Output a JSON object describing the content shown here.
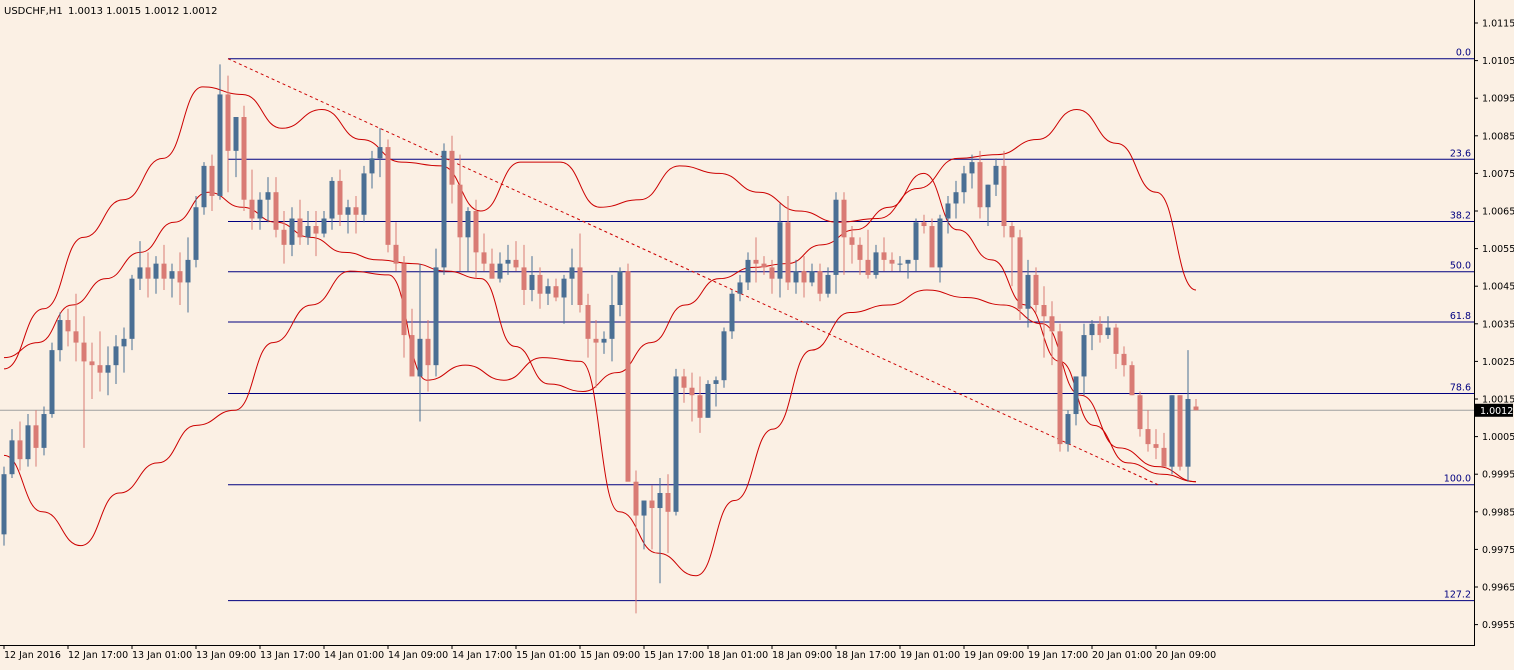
{
  "header": {
    "symbol": "USDCHF,H1",
    "ohlc": "1.0013 1.0015 1.0012 1.0012"
  },
  "colors": {
    "background": "#FBF0E4",
    "bull_candle": "#4A6F94",
    "bear_candle": "#D97B74",
    "bollinger": "#CC0000",
    "fib_lines": "#000080",
    "trendline": "#CC0000",
    "axis": "#000000"
  },
  "chart_data": {
    "type": "candlestick",
    "symbol": "USDCHF",
    "timeframe": "H1",
    "current_price": "1.0012",
    "price_axis": {
      "ticks": [
        "1.0115",
        "1.0105",
        "1.0095",
        "1.0085",
        "1.0075",
        "1.0065",
        "1.0055",
        "1.0045",
        "1.0035",
        "1.0025",
        "1.0015",
        "1.0005",
        "0.9995",
        "0.9985",
        "0.9975",
        "0.9965",
        "0.9955"
      ],
      "range": [
        0.9952,
        1.0118
      ]
    },
    "time_axis": {
      "labels": [
        "12 Jan 2016",
        "12 Jan 17:00",
        "13 Jan 01:00",
        "13 Jan 09:00",
        "13 Jan 17:00",
        "14 Jan 01:00",
        "14 Jan 09:00",
        "14 Jan 17:00",
        "15 Jan 01:00",
        "15 Jan 09:00",
        "15 Jan 17:00",
        "18 Jan 01:00",
        "18 Jan 09:00",
        "18 Jan 17:00",
        "19 Jan 01:00",
        "19 Jan 09:00",
        "19 Jan 17:00",
        "20 Jan 01:00",
        "20 Jan 09:00"
      ]
    },
    "fibonacci": {
      "high": 1.01055,
      "low": 0.99922,
      "levels": [
        {
          "label": "0.0",
          "ratio": 0.0
        },
        {
          "label": "23.6",
          "ratio": 0.236
        },
        {
          "label": "38.2",
          "ratio": 0.382
        },
        {
          "label": "50.0",
          "ratio": 0.5
        },
        {
          "label": "61.8",
          "ratio": 0.618
        },
        {
          "label": "78.6",
          "ratio": 0.786
        },
        {
          "label": "100.0",
          "ratio": 1.0
        },
        {
          "label": "127.2",
          "ratio": 1.272
        }
      ]
    },
    "candles": [
      [
        0.9979,
        0.9997,
        0.9976,
        0.9995
      ],
      [
        0.9995,
        1.0007,
        0.9994,
        1.0004
      ],
      [
        1.0004,
        1.0009,
        0.9996,
        0.9999
      ],
      [
        0.9999,
        1.0011,
        0.9997,
        1.0008
      ],
      [
        1.0008,
        1.0012,
        0.9997,
        1.0002
      ],
      [
        1.0002,
        1.0013,
        1.0,
        1.0011
      ],
      [
        1.0011,
        1.003,
        1.001,
        1.0028
      ],
      [
        1.0028,
        1.0038,
        1.0025,
        1.0036
      ],
      [
        1.0036,
        1.0039,
        1.0029,
        1.0033
      ],
      [
        1.0033,
        1.0043,
        1.0025,
        1.003
      ],
      [
        1.003,
        1.0037,
        1.0002,
        1.0025
      ],
      [
        1.0025,
        1.003,
        1.0015,
        1.0024
      ],
      [
        1.0024,
        1.0033,
        1.0017,
        1.0022
      ],
      [
        1.0022,
        1.0029,
        1.0016,
        1.0024
      ],
      [
        1.0024,
        1.0032,
        1.0019,
        1.0029
      ],
      [
        1.0029,
        1.0034,
        1.0022,
        1.0031
      ],
      [
        1.0031,
        1.0048,
        1.0028,
        1.0047
      ],
      [
        1.0047,
        1.0057,
        1.0044,
        1.005
      ],
      [
        1.005,
        1.0054,
        1.0042,
        1.0047
      ],
      [
        1.0047,
        1.0053,
        1.0043,
        1.0051
      ],
      [
        1.0051,
        1.0056,
        1.0044,
        1.0047
      ],
      [
        1.0047,
        1.0051,
        1.0042,
        1.0049
      ],
      [
        1.0049,
        1.0054,
        1.004,
        1.0046
      ],
      [
        1.0046,
        1.0058,
        1.0038,
        1.0052
      ],
      [
        1.0052,
        1.0069,
        1.005,
        1.0066
      ],
      [
        1.0066,
        1.0078,
        1.0064,
        1.0077
      ],
      [
        1.0077,
        1.008,
        1.0065,
        1.0069
      ],
      [
        1.0069,
        1.0104,
        1.0068,
        1.0096
      ],
      [
        1.0096,
        1.0101,
        1.007,
        1.0081
      ],
      [
        1.0081,
        1.0088,
        1.0074,
        1.009
      ],
      [
        1.009,
        1.0093,
        1.0065,
        1.0068
      ],
      [
        1.0068,
        1.0076,
        1.006,
        1.0063
      ],
      [
        1.0063,
        1.007,
        1.006,
        1.0068
      ],
      [
        1.0068,
        1.0074,
        1.0062,
        1.007
      ],
      [
        1.007,
        1.0074,
        1.0058,
        1.006
      ],
      [
        1.006,
        1.0065,
        1.0051,
        1.0056
      ],
      [
        1.0056,
        1.0066,
        1.0053,
        1.0063
      ],
      [
        1.0063,
        1.0068,
        1.0056,
        1.0058
      ],
      [
        1.0058,
        1.0065,
        1.0056,
        1.0061
      ],
      [
        1.0061,
        1.0065,
        1.0053,
        1.0059
      ],
      [
        1.0059,
        1.0065,
        1.0058,
        1.0063
      ],
      [
        1.0063,
        1.0074,
        1.006,
        1.0073
      ],
      [
        1.0073,
        1.0076,
        1.0061,
        1.0064
      ],
      [
        1.0064,
        1.0068,
        1.0059,
        1.0066
      ],
      [
        1.0066,
        1.0069,
        1.0059,
        1.0064
      ],
      [
        1.0064,
        1.0077,
        1.0062,
        1.0075
      ],
      [
        1.0075,
        1.0081,
        1.0071,
        1.0079
      ],
      [
        1.0079,
        1.0087,
        1.0074,
        1.0082
      ],
      [
        1.0082,
        1.0084,
        1.0054,
        1.0056
      ],
      [
        1.0056,
        1.0062,
        1.0049,
        1.0051
      ],
      [
        1.0051,
        1.0053,
        1.0026,
        1.0032
      ],
      [
        1.0032,
        1.0039,
        1.0022,
        1.0021
      ],
      [
        1.0021,
        1.0051,
        1.0009,
        1.0031
      ],
      [
        1.0031,
        1.0036,
        1.0017,
        1.0024
      ],
      [
        1.0024,
        1.0055,
        1.0021,
        1.005
      ],
      [
        1.005,
        1.0083,
        1.0048,
        1.0081
      ],
      [
        1.0081,
        1.0085,
        1.0067,
        1.0072
      ],
      [
        1.0072,
        1.008,
        1.0049,
        1.0058
      ],
      [
        1.0058,
        1.0066,
        1.0049,
        1.0065
      ],
      [
        1.0065,
        1.0068,
        1.0047,
        1.0054
      ],
      [
        1.0054,
        1.0059,
        1.0049,
        1.0051
      ],
      [
        1.0051,
        1.0055,
        1.0047,
        1.0047
      ],
      [
        1.0047,
        1.0054,
        1.0046,
        1.0051
      ],
      [
        1.0051,
        1.0056,
        1.0048,
        1.0052
      ],
      [
        1.0052,
        1.0057,
        1.0049,
        1.005
      ],
      [
        1.005,
        1.0056,
        1.004,
        1.0044
      ],
      [
        1.0044,
        1.0053,
        1.0041,
        1.0048
      ],
      [
        1.0048,
        1.005,
        1.0039,
        1.0043
      ],
      [
        1.0043,
        1.0047,
        1.004,
        1.0045
      ],
      [
        1.0045,
        1.0047,
        1.0041,
        1.0042
      ],
      [
        1.0042,
        1.0048,
        1.0035,
        1.0047
      ],
      [
        1.0047,
        1.0055,
        1.004,
        1.005
      ],
      [
        1.005,
        1.0059,
        1.0038,
        1.004
      ],
      [
        1.004,
        1.0043,
        1.0026,
        1.0031
      ],
      [
        1.0031,
        1.0036,
        1.0018,
        1.003
      ],
      [
        1.003,
        1.0033,
        1.0027,
        1.0031
      ],
      [
        1.0031,
        1.0048,
        1.0025,
        1.004
      ],
      [
        1.004,
        1.005,
        1.0037,
        1.0049
      ],
      [
        1.0049,
        1.0051,
        0.9996,
        0.9993
      ],
      [
        0.9993,
        0.9996,
        0.9958,
        0.9984
      ],
      [
        0.9984,
        0.9988,
        0.9975,
        0.9988
      ],
      [
        0.9988,
        0.9992,
        0.9975,
        0.9986
      ],
      [
        0.9986,
        0.9994,
        0.9966,
        0.999
      ],
      [
        0.999,
        0.9995,
        0.9974,
        0.9985
      ],
      [
        0.9985,
        1.0023,
        0.9984,
        1.0021
      ],
      [
        1.0021,
        1.0023,
        1.0014,
        1.0018
      ],
      [
        1.0018,
        1.0022,
        1.0009,
        1.0016
      ],
      [
        1.0016,
        1.0021,
        1.0006,
        1.001
      ],
      [
        1.001,
        1.002,
        1.001,
        1.0019
      ],
      [
        1.0019,
        1.0021,
        1.0013,
        1.002
      ],
      [
        1.002,
        1.0034,
        1.0018,
        1.0033
      ],
      [
        1.0033,
        1.0044,
        1.0031,
        1.0043
      ],
      [
        1.0043,
        1.0048,
        1.0041,
        1.0046
      ],
      [
        1.0046,
        1.0054,
        1.0044,
        1.0052
      ],
      [
        1.0052,
        1.0058,
        1.0046,
        1.0051
      ],
      [
        1.0051,
        1.0053,
        1.0048,
        1.005
      ],
      [
        1.005,
        1.0052,
        1.0043,
        1.0047
      ],
      [
        1.0047,
        1.0067,
        1.0042,
        1.0062
      ],
      [
        1.0062,
        1.0069,
        1.0044,
        1.0046
      ],
      [
        1.0046,
        1.0052,
        1.0043,
        1.0049
      ],
      [
        1.0049,
        1.0053,
        1.0042,
        1.0046
      ],
      [
        1.0046,
        1.0051,
        1.0045,
        1.0049
      ],
      [
        1.0049,
        1.0051,
        1.0041,
        1.0043
      ],
      [
        1.0043,
        1.005,
        1.0042,
        1.0048
      ],
      [
        1.0048,
        1.007,
        1.0043,
        1.0068
      ],
      [
        1.0068,
        1.007,
        1.0048,
        1.0058
      ],
      [
        1.0058,
        1.0061,
        1.0051,
        1.0056
      ],
      [
        1.0056,
        1.0058,
        1.0048,
        1.0052
      ],
      [
        1.0052,
        1.006,
        1.0047,
        1.0048
      ],
      [
        1.0048,
        1.0056,
        1.0047,
        1.0054
      ],
      [
        1.0054,
        1.0058,
        1.0049,
        1.0052
      ],
      [
        1.0052,
        1.0054,
        1.0049,
        1.0051
      ],
      [
        1.0051,
        1.0053,
        1.0049,
        1.0051
      ],
      [
        1.0051,
        1.0052,
        1.0047,
        1.0052
      ],
      [
        1.0052,
        1.0063,
        1.0049,
        1.0062
      ],
      [
        1.0062,
        1.0064,
        1.0059,
        1.0061
      ],
      [
        1.0061,
        1.0063,
        1.0051,
        1.005
      ],
      [
        1.005,
        1.0064,
        1.0046,
        1.0063
      ],
      [
        1.0063,
        1.0069,
        1.0059,
        1.0067
      ],
      [
        1.0067,
        1.0073,
        1.0063,
        1.007
      ],
      [
        1.007,
        1.0077,
        1.0067,
        1.0075
      ],
      [
        1.0075,
        1.008,
        1.0071,
        1.0078
      ],
      [
        1.0078,
        1.0081,
        1.0063,
        1.0066
      ],
      [
        1.0066,
        1.0072,
        1.0061,
        1.0072
      ],
      [
        1.0072,
        1.0079,
        1.0069,
        1.0077
      ],
      [
        1.0077,
        1.0081,
        1.0058,
        1.0061
      ],
      [
        1.0061,
        1.0062,
        1.0045,
        1.0058
      ],
      [
        1.0058,
        1.006,
        1.0036,
        1.0039
      ],
      [
        1.0039,
        1.0052,
        1.0034,
        1.0048
      ],
      [
        1.0048,
        1.005,
        1.0038,
        1.004
      ],
      [
        1.004,
        1.0045,
        1.0026,
        1.0037
      ],
      [
        1.0037,
        1.0041,
        1.0024,
        1.0033
      ],
      [
        1.0033,
        1.0035,
        1.0001,
        1.0003
      ],
      [
        1.0003,
        1.0012,
        1.0001,
        1.0011
      ],
      [
        1.0011,
        1.0021,
        1.0008,
        1.0021
      ],
      [
        1.0021,
        1.0035,
        1.0016,
        1.0032
      ],
      [
        1.0032,
        1.0036,
        1.0028,
        1.0035
      ],
      [
        1.0035,
        1.0037,
        1.003,
        1.0032
      ],
      [
        1.0032,
        1.0037,
        1.0031,
        1.0034
      ],
      [
        1.0034,
        1.0035,
        1.0023,
        1.0027
      ],
      [
        1.0027,
        1.0029,
        1.0021,
        1.0024
      ],
      [
        1.0024,
        1.0025,
        1.0016,
        1.0016
      ],
      [
        1.0016,
        1.0017,
        1.0005,
        1.0007
      ],
      [
        1.0007,
        1.0012,
        1.0001,
        1.0003
      ],
      [
        1.0003,
        1.0007,
        0.9999,
        1.0002
      ],
      [
        1.0002,
        1.0006,
        0.9998,
        0.9997
      ],
      [
        0.9997,
        1.0016,
        0.9995,
        1.0016
      ],
      [
        1.0016,
        1.0016,
        0.9996,
        0.9997
      ],
      [
        0.9997,
        1.0028,
        0.9993,
        1.0015
      ],
      [
        1.0013,
        1.0015,
        1.0012,
        1.0012
      ]
    ],
    "bollinger_middle": [
      1.0026,
      1.003,
      1.004,
      1.0047,
      1.0054,
      1.0062,
      1.007,
      1.0066,
      1.0062,
      1.0058,
      1.0054,
      1.0052,
      1.0051,
      1.0049,
      1.0047,
      1.0029,
      1.0019,
      1.0017,
      1.0022,
      1.003,
      1.004,
      1.0047,
      1.005,
      1.0051,
      1.0056,
      1.006,
      1.0066,
      1.0075,
      1.006,
      1.0052,
      1.004,
      1.0025,
      1.0008,
      0.9998,
      0.9995,
      0.9993
    ],
    "bollinger_upper": [
      1.0023,
      1.0039,
      1.0058,
      1.0068,
      1.0079,
      1.0098,
      1.0096,
      1.0087,
      1.0092,
      1.0084,
      1.0078,
      1.0077,
      1.0065,
      1.0078,
      1.0078,
      1.0066,
      1.0068,
      1.0077,
      1.0075,
      1.007,
      1.0065,
      1.0062,
      1.0063,
      1.0071,
      1.0079,
      1.008,
      1.0084,
      1.0092,
      1.0083,
      1.007,
      1.0044
    ],
    "bollinger_lower": [
      1.0,
      0.9985,
      0.9976,
      0.999,
      0.9998,
      1.0008,
      1.0012,
      1.003,
      1.004,
      1.0049,
      1.0048,
      1.002,
      1.0024,
      1.002,
      1.0026,
      1.0025,
      0.9985,
      0.9974,
      0.9968,
      0.9988,
      1.0007,
      1.0028,
      1.0038,
      1.004,
      1.0044,
      1.0042,
      1.004,
      1.0035,
      1.0016,
      1.0002,
      0.9997,
      0.9993
    ]
  }
}
